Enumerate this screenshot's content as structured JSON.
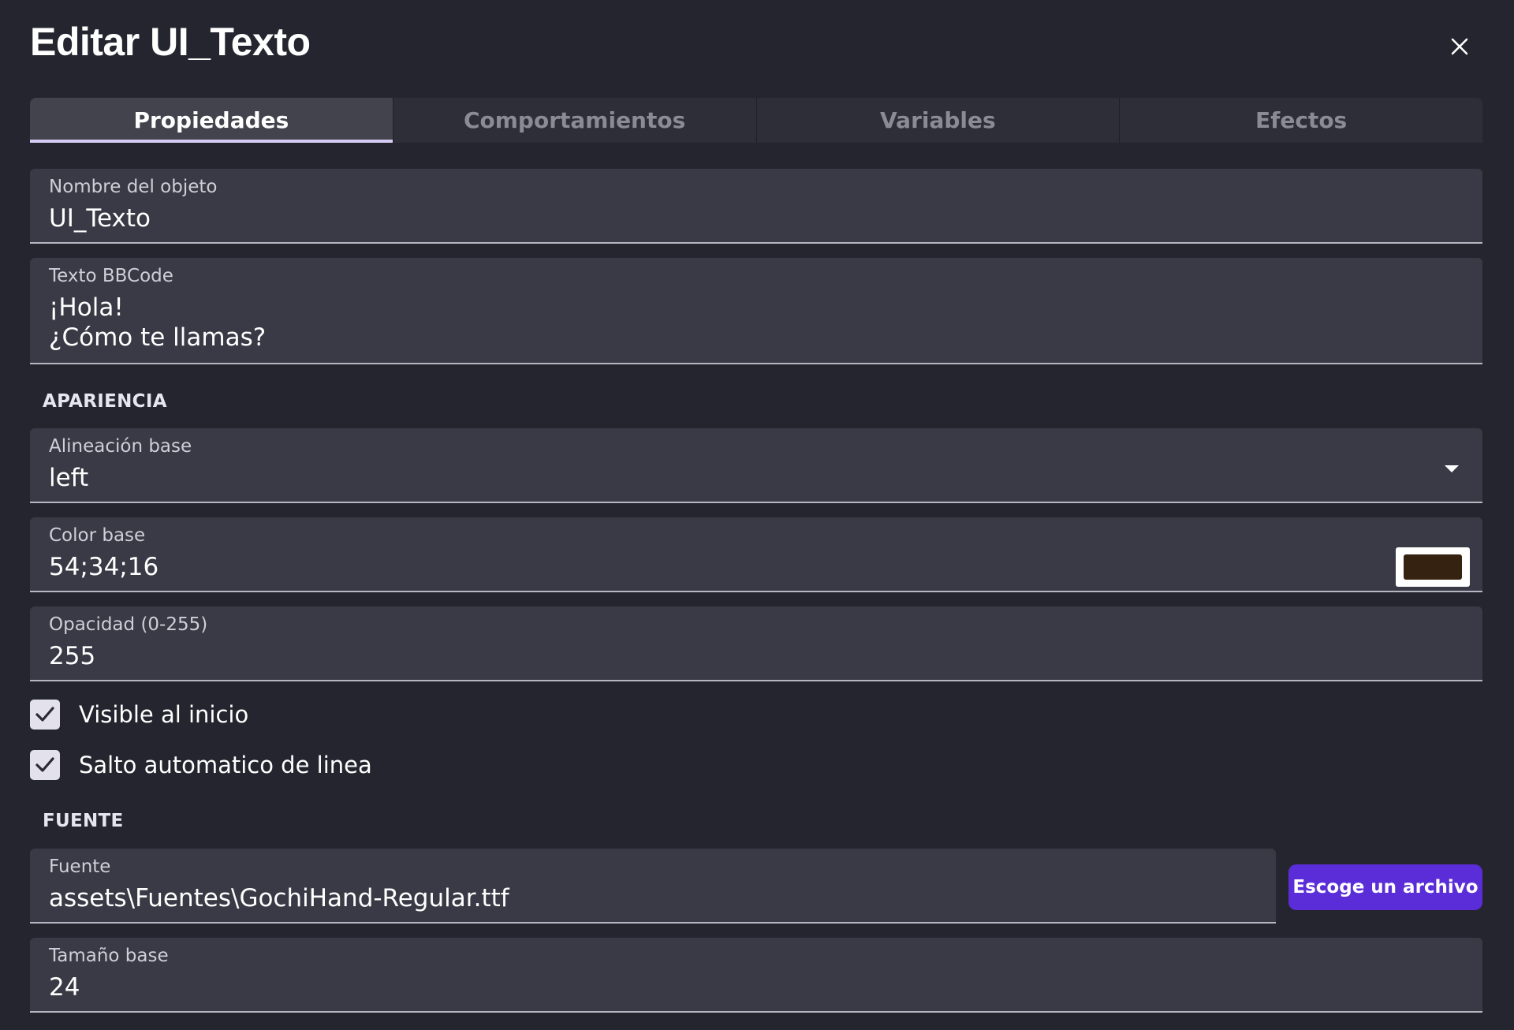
{
  "dialog": {
    "title": "Editar UI_Texto"
  },
  "tabs": [
    {
      "label": "Propiedades",
      "active": true
    },
    {
      "label": "Comportamientos",
      "active": false
    },
    {
      "label": "Variables",
      "active": false
    },
    {
      "label": "Efectos",
      "active": false
    }
  ],
  "fields": {
    "object_name": {
      "label": "Nombre del objeto",
      "value": "UI_Texto"
    },
    "bbcode_text": {
      "label": "Texto BBCode",
      "value": "¡Hola!\n¿Cómo te llamas?"
    },
    "base_alignment": {
      "label": "Alineación base",
      "value": "left"
    },
    "base_color": {
      "label": "Color base",
      "value": "54;34;16",
      "swatch_color": "#362210"
    },
    "opacity": {
      "label": "Opacidad (0-255)",
      "value": "255"
    },
    "font": {
      "label": "Fuente",
      "value": "assets\\Fuentes\\GochiHand-Regular.ttf"
    },
    "base_size": {
      "label": "Tamaño base",
      "value": "24"
    }
  },
  "sections": {
    "appearance": "APARIENCIA",
    "font": "FUENTE"
  },
  "checkboxes": {
    "visible_at_start": {
      "label": "Visible al inicio",
      "checked": true
    },
    "word_wrap": {
      "label": "Salto automatico de linea",
      "checked": true
    }
  },
  "buttons": {
    "choose_file": "Escoge un archivo"
  },
  "icons": {
    "close": "close-icon",
    "dropdown": "chevron-down-icon",
    "check": "check-icon"
  },
  "colors": {
    "background": "#25252f",
    "field": "#3a3a46",
    "accent": "#5b2dd8",
    "tab_indicator": "#d7ccf3"
  }
}
